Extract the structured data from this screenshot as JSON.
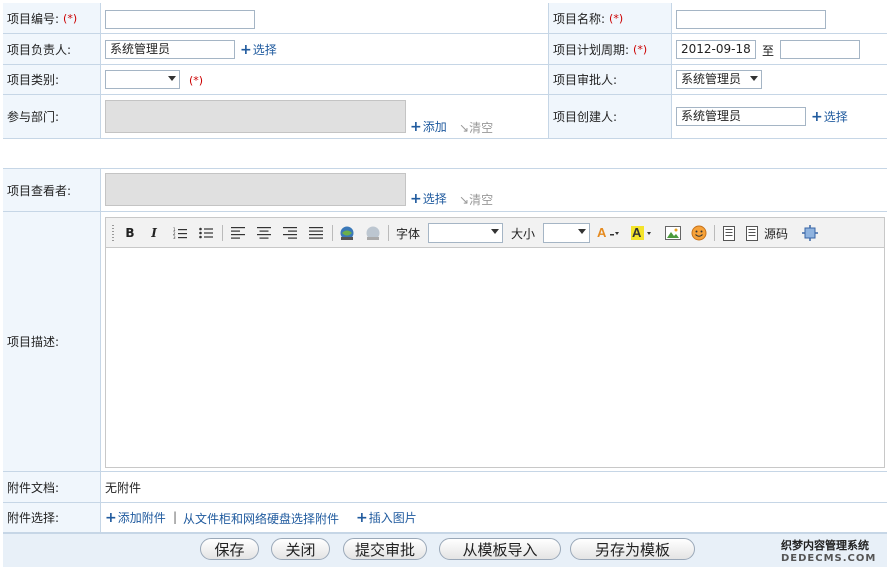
{
  "fields": {
    "project_no_label": "项目编号:",
    "project_name_label": "项目名称:",
    "owner_label": "项目负责人:",
    "owner_value": "系统管理员",
    "period_label": "项目计划周期:",
    "period_start": "2012-09-18",
    "period_to": "至",
    "category_label": "项目类别:",
    "approver_label": "项目审批人:",
    "approver_value": "系统管理员",
    "dept_label": "参与部门:",
    "creator_label": "项目创建人:",
    "creator_value": "系统管理员",
    "viewer_label": "项目查看者:",
    "desc_label": "项目描述:",
    "attach_doc_label": "附件文档:",
    "attach_doc_value": "无附件",
    "attach_select_label": "附件选择:",
    "required_mark": "(*)"
  },
  "links": {
    "select": "选择",
    "add": "添加",
    "clear": "清空",
    "add_attachment": "添加附件",
    "from_cabinet": "从文件柜和网络硬盘选择附件",
    "insert_image": "插入图片"
  },
  "toolbar": {
    "bold": "B",
    "italic": "I",
    "font_label": "字体",
    "size_label": "大小",
    "source_label": "源码"
  },
  "buttons": {
    "save": "保存",
    "close": "关闭",
    "submit": "提交审批",
    "import_template": "从模板导入",
    "save_template": "另存为模板"
  },
  "watermark": {
    "line1": "织梦内容管理系统",
    "line2": "DEDECMS.COM"
  }
}
